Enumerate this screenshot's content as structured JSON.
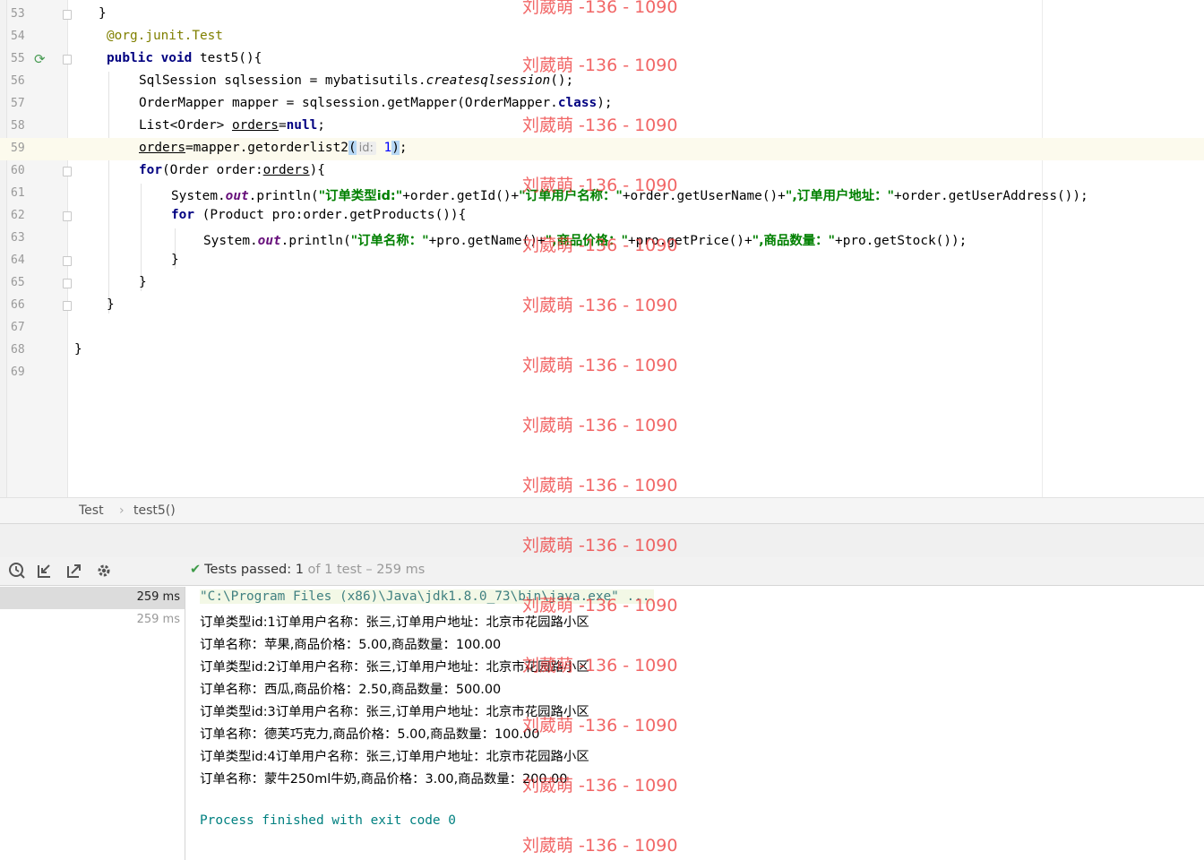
{
  "editor": {
    "line_numbers": [
      "53",
      "54",
      "55",
      "56",
      "57",
      "58",
      "59",
      "60",
      "61",
      "62",
      "63",
      "64",
      "65",
      "66",
      "67",
      "68",
      "69"
    ],
    "lines": {
      "l53": "}",
      "l54_at": "@org.junit.",
      "l54_test": "Test",
      "l55_kw": "public void",
      "l55_rest": " test5(){",
      "l56_a": "SqlSession sqlsession = mybatisutils.",
      "l56_b": "createsqlsession",
      "l56_c": "();",
      "l57_a": "OrderMapper mapper = sqlsession.getMapper(OrderMapper.",
      "l57_b": "class",
      "l57_c": ");",
      "l58_a": "List<Order> ",
      "l58_b": "orders",
      "l58_c": "=",
      "l58_d": "null",
      "l58_e": ";",
      "l59_a": "orders",
      "l59_b": "=mapper.getorderlist2",
      "l59_open": "(",
      "l59_hint": "id:",
      "l59_num": "1",
      "l59_close": ")",
      "l59_end": ";",
      "l60_kw": "for",
      "l60_a": "(Order order:",
      "l60_b": "orders",
      "l60_c": "){",
      "l61_a": "System.",
      "l61_out": "out",
      "l61_b": ".println(",
      "l61_s1": "\"订单类型id:\"",
      "l61_c": "+order.getId()+",
      "l61_s2": "\"订单用户名称：\"",
      "l61_d": "+order.getUserName()+",
      "l61_s3": "\",订单用户地址：\"",
      "l61_e": "+order.getUserAddress());",
      "l62_kw": "for",
      "l62_a": " (Product pro:order.getProducts()){",
      "l63_a": "System.",
      "l63_out": "out",
      "l63_b": ".println(",
      "l63_s1": "\"订单名称：\"",
      "l63_c": "+pro.getName()+",
      "l63_s2": "\",商品价格：\"",
      "l63_d": "+pro.getPrice()+",
      "l63_s3": "\",商品数量：\"",
      "l63_e": "+pro.getStock());",
      "l64": "}",
      "l65": "}",
      "l66": "}",
      "l68": "}"
    }
  },
  "breadcrumb": {
    "class_name": "Test",
    "separator": "›",
    "method_name": "test5()"
  },
  "run_toolbar": {
    "icons": [
      "history-icon",
      "import-tests-icon",
      "export-icon",
      "settings-icon"
    ],
    "status_label": "Tests passed:",
    "status_count": "1",
    "status_detail": "of 1 test – 259 ms"
  },
  "test_tree": {
    "rows": [
      "259 ms",
      "259 ms"
    ]
  },
  "console": {
    "command": "\"C:\\Program Files (x86)\\Java\\jdk1.8.0_73\\bin\\java.exe\" ...",
    "output": [
      "订单类型id:1订单用户名称：张三,订单用户地址：北京市花园路小区",
      "订单名称：苹果,商品价格：5.00,商品数量：100.00",
      "订单类型id:2订单用户名称：张三,订单用户地址：北京市花园路小区",
      "订单名称：西瓜,商品价格：2.50,商品数量：500.00",
      "订单类型id:3订单用户名称：张三,订单用户地址：北京市花园路小区",
      "订单名称：德芙巧克力,商品价格：5.00,商品数量：100.00",
      "订单类型id:4订单用户名称：张三,订单用户地址：北京市花园路小区",
      "订单名称：蒙牛250ml牛奶,商品价格：3.00,商品数量：200.00"
    ],
    "exit_message": "Process finished with exit code 0"
  },
  "watermark": {
    "text": "刘葳萌 -136 - 1090",
    "color": "#ee3c3c"
  },
  "colors": {
    "keyword": "#000080",
    "string": "#008000",
    "annotation": "#808000",
    "field": "#660e7a",
    "pass": "#3e9b49"
  }
}
